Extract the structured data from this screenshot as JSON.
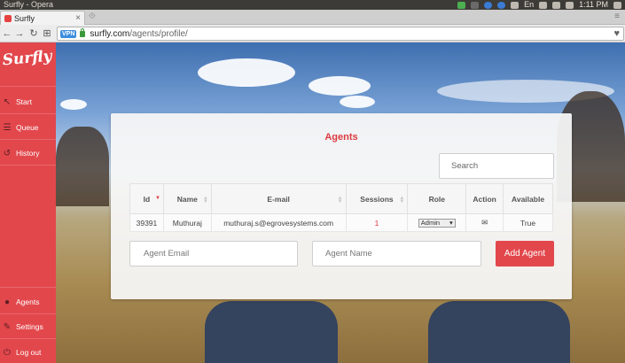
{
  "os": {
    "window_title": "Surfly - Opera",
    "clock": "1:11 PM",
    "keyboard": "En"
  },
  "browser": {
    "tab_title": "Surfly",
    "vpn_badge": "VPN",
    "url_host": "surfly.com",
    "url_path": "/agents/profile/"
  },
  "sidebar": {
    "logo": "Surfly",
    "items": [
      {
        "label": "Start",
        "icon": "cursor-icon"
      },
      {
        "label": "Queue",
        "icon": "queue-icon"
      },
      {
        "label": "History",
        "icon": "history-icon"
      },
      {
        "label": "Agents",
        "icon": "agents-icon"
      },
      {
        "label": "Settings",
        "icon": "wrench-icon"
      },
      {
        "label": "Log out",
        "icon": "power-icon"
      }
    ]
  },
  "card": {
    "title": "Agents",
    "search_placeholder": "Search",
    "columns": [
      "Id",
      "Name",
      "E-mail",
      "Sessions",
      "Role",
      "Action",
      "Available"
    ],
    "rows": [
      {
        "id": "39391",
        "name": "Muthuraj",
        "email": "muthuraj.s@egrovesystems.com",
        "sessions": "1",
        "role": "Admin",
        "available": "True"
      }
    ],
    "email_placeholder": "Agent Email",
    "name_placeholder": "Agent Name",
    "add_button": "Add Agent"
  },
  "colors": {
    "accent": "#e2474c",
    "title_red": "#dd3b40"
  }
}
